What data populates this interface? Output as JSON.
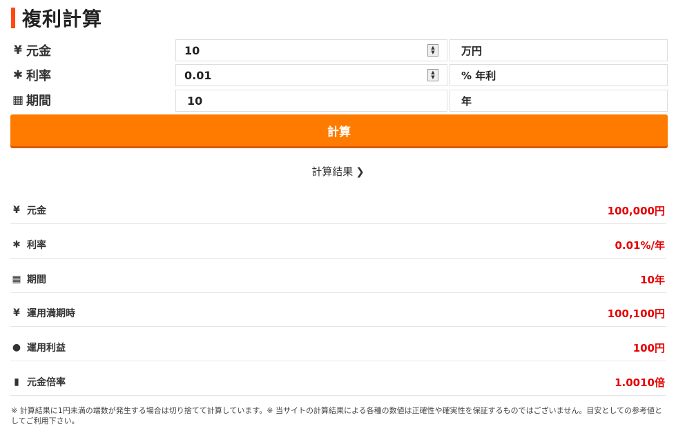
{
  "title": "複利計算",
  "form": {
    "principal": {
      "icon": "yen-icon",
      "glyph": "¥",
      "label": "元金",
      "value": "10",
      "unit": "万円"
    },
    "rate": {
      "icon": "asterisk-icon",
      "glyph": "✱",
      "label": "利率",
      "value": "0.01",
      "unit": "% 年利"
    },
    "period": {
      "icon": "calendar-icon",
      "glyph": "▦",
      "label": "期間",
      "value": "10",
      "unit": "年"
    },
    "calc_label": "計算"
  },
  "results_header": "計算結果",
  "results": [
    {
      "icon": "yen-icon",
      "glyph": "¥",
      "label": "元金",
      "value": "100,000円"
    },
    {
      "icon": "asterisk-icon",
      "glyph": "✱",
      "label": "利率",
      "value": "0.01%/年"
    },
    {
      "icon": "calendar-icon",
      "glyph": "▦",
      "label": "期間",
      "value": "10年"
    },
    {
      "icon": "yen-icon",
      "glyph": "¥",
      "label": "運用満期時",
      "value": "100,100円"
    },
    {
      "icon": "piggy-bank-icon",
      "glyph": "●",
      "label": "運用利益",
      "value": "100円"
    },
    {
      "icon": "bar-chart-icon",
      "glyph": "▮",
      "label": "元金倍率",
      "value": "1.0010倍"
    }
  ],
  "note": "※ 計算結果に1円未満の端数が発生する場合は切り捨てて計算しています。※ 当サイトの計算結果による各種の数値は正確性や確実性を保証するものではございません。目安としての参考値としてご利用下さい。",
  "colors": {
    "accent": "#ff7b00",
    "title_bar": "#ff4a14",
    "result_value": "#e60000"
  }
}
